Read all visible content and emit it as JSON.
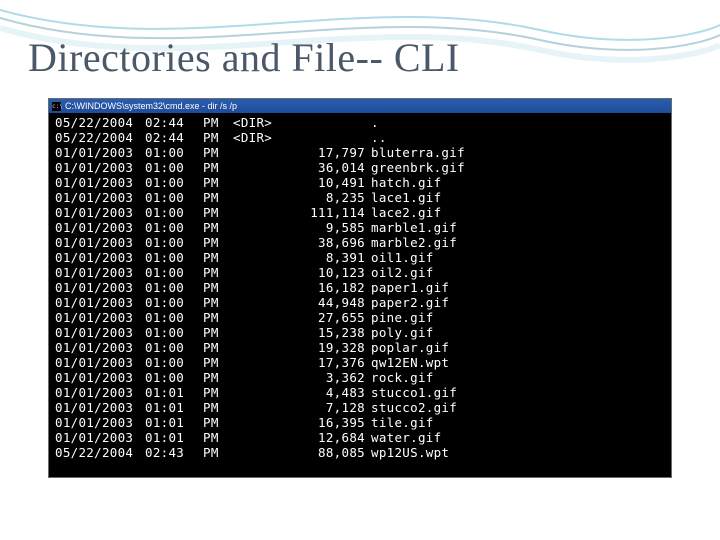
{
  "slide": {
    "title": "Directories and File-- CLI"
  },
  "cmd": {
    "titlebar": "C:\\WINDOWS\\system32\\cmd.exe - dir /s /p",
    "columns": [
      "date",
      "time",
      "ampm",
      "dir",
      "size",
      "name"
    ],
    "rows": [
      {
        "date": "05/22/2004",
        "time": "02:44",
        "ampm": "PM",
        "dir": "<DIR>",
        "size": "",
        "name": "."
      },
      {
        "date": "05/22/2004",
        "time": "02:44",
        "ampm": "PM",
        "dir": "<DIR>",
        "size": "",
        "name": ".."
      },
      {
        "date": "01/01/2003",
        "time": "01:00",
        "ampm": "PM",
        "dir": "",
        "size": "17,797",
        "name": "bluterra.gif"
      },
      {
        "date": "01/01/2003",
        "time": "01:00",
        "ampm": "PM",
        "dir": "",
        "size": "36,014",
        "name": "greenbrk.gif"
      },
      {
        "date": "01/01/2003",
        "time": "01:00",
        "ampm": "PM",
        "dir": "",
        "size": "10,491",
        "name": "hatch.gif"
      },
      {
        "date": "01/01/2003",
        "time": "01:00",
        "ampm": "PM",
        "dir": "",
        "size": "8,235",
        "name": "lace1.gif"
      },
      {
        "date": "01/01/2003",
        "time": "01:00",
        "ampm": "PM",
        "dir": "",
        "size": "111,114",
        "name": "lace2.gif"
      },
      {
        "date": "01/01/2003",
        "time": "01:00",
        "ampm": "PM",
        "dir": "",
        "size": "9,585",
        "name": "marble1.gif"
      },
      {
        "date": "01/01/2003",
        "time": "01:00",
        "ampm": "PM",
        "dir": "",
        "size": "38,696",
        "name": "marble2.gif"
      },
      {
        "date": "01/01/2003",
        "time": "01:00",
        "ampm": "PM",
        "dir": "",
        "size": "8,391",
        "name": "oil1.gif"
      },
      {
        "date": "01/01/2003",
        "time": "01:00",
        "ampm": "PM",
        "dir": "",
        "size": "10,123",
        "name": "oil2.gif"
      },
      {
        "date": "01/01/2003",
        "time": "01:00",
        "ampm": "PM",
        "dir": "",
        "size": "16,182",
        "name": "paper1.gif"
      },
      {
        "date": "01/01/2003",
        "time": "01:00",
        "ampm": "PM",
        "dir": "",
        "size": "44,948",
        "name": "paper2.gif"
      },
      {
        "date": "01/01/2003",
        "time": "01:00",
        "ampm": "PM",
        "dir": "",
        "size": "27,655",
        "name": "pine.gif"
      },
      {
        "date": "01/01/2003",
        "time": "01:00",
        "ampm": "PM",
        "dir": "",
        "size": "15,238",
        "name": "poly.gif"
      },
      {
        "date": "01/01/2003",
        "time": "01:00",
        "ampm": "PM",
        "dir": "",
        "size": "19,328",
        "name": "poplar.gif"
      },
      {
        "date": "01/01/2003",
        "time": "01:00",
        "ampm": "PM",
        "dir": "",
        "size": "17,376",
        "name": "qw12EN.wpt"
      },
      {
        "date": "01/01/2003",
        "time": "01:00",
        "ampm": "PM",
        "dir": "",
        "size": "3,362",
        "name": "rock.gif"
      },
      {
        "date": "01/01/2003",
        "time": "01:01",
        "ampm": "PM",
        "dir": "",
        "size": "4,483",
        "name": "stucco1.gif"
      },
      {
        "date": "01/01/2003",
        "time": "01:01",
        "ampm": "PM",
        "dir": "",
        "size": "7,128",
        "name": "stucco2.gif"
      },
      {
        "date": "01/01/2003",
        "time": "01:01",
        "ampm": "PM",
        "dir": "",
        "size": "16,395",
        "name": "tile.gif"
      },
      {
        "date": "01/01/2003",
        "time": "01:01",
        "ampm": "PM",
        "dir": "",
        "size": "12,684",
        "name": "water.gif"
      },
      {
        "date": "05/22/2004",
        "time": "02:43",
        "ampm": "PM",
        "dir": "",
        "size": "88,085",
        "name": "wp12US.wpt"
      }
    ]
  }
}
